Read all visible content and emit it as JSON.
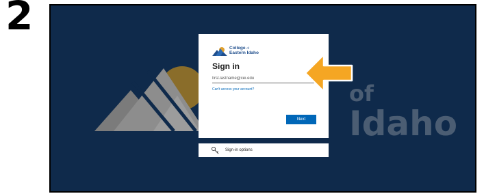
{
  "step": {
    "number": "2"
  },
  "background": {
    "brand_word_1": "of",
    "brand_word_2": "Idaho",
    "color": "#0f2a4b"
  },
  "signin": {
    "logo_line1_prefix": "College",
    "logo_line1_suffix": "of",
    "logo_line2": "Eastern Idaho",
    "title": "Sign in",
    "email_placeholder": "first.lastname@cei.edu",
    "cant_access": "Can't access your account?",
    "next_label": "Next",
    "accent_color": "#0067b8"
  },
  "options": {
    "label": "Sign-in options",
    "icon": "key-icon"
  },
  "annotation": {
    "arrow_color": "#f5a623",
    "points_to": "email-input"
  }
}
